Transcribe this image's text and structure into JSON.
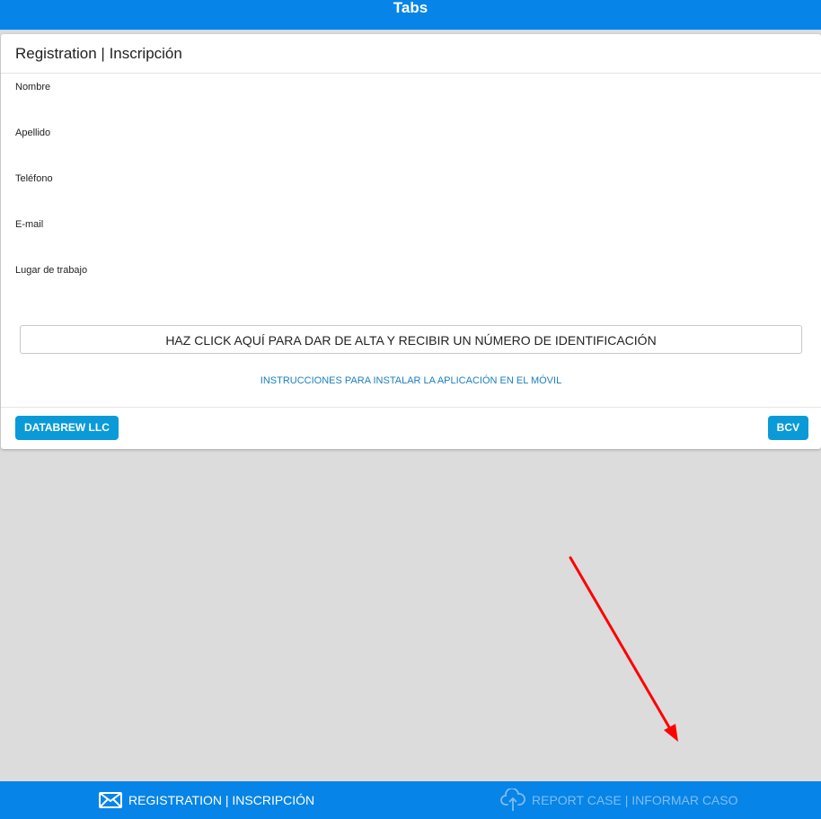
{
  "header": {
    "title": "Tabs"
  },
  "card": {
    "title": "Registration | Inscripción",
    "fields": [
      {
        "label": "Nombre",
        "value": ""
      },
      {
        "label": "Apellido",
        "value": ""
      },
      {
        "label": "Teléfono",
        "value": ""
      },
      {
        "label": "E-mail",
        "value": ""
      },
      {
        "label": "Lugar de trabajo",
        "value": ""
      }
    ],
    "submit_label": "HAZ CLICK AQUÍ PARA DAR DE ALTA Y RECIBIR UN NÚMERO DE IDENTIFICACIÓN",
    "instructions_link": "INSTRUCCIONES PARA INSTALAR LA APLICACIÓN EN EL MÓVIL",
    "footer_left_button": "DATABREW LLC",
    "footer_right_button": "BCV"
  },
  "tabs": [
    {
      "label": "REGISTRATION | INSCRIPCIÓN",
      "icon": "mail-icon",
      "active": true
    },
    {
      "label": "REPORT CASE | INFORMAR CASO",
      "icon": "cloud-upload-icon",
      "active": false
    }
  ],
  "colors": {
    "primary": "#0684e8",
    "pill": "#0a9ad8",
    "link": "#1a7fc1",
    "annotation": "#ff0000",
    "background": "#dcdcdc"
  }
}
